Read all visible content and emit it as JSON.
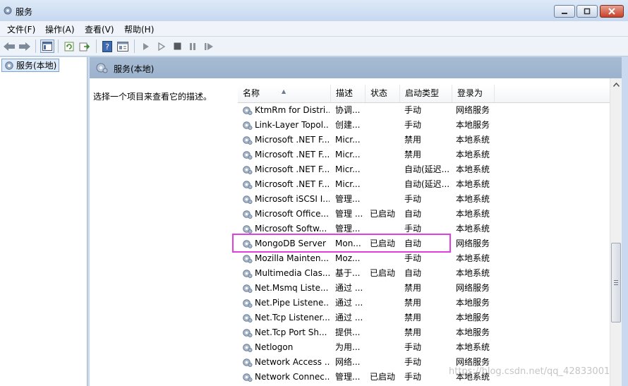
{
  "window": {
    "title": "服务"
  },
  "menu": [
    {
      "label": "文件(F)"
    },
    {
      "label": "操作(A)"
    },
    {
      "label": "查看(V)"
    },
    {
      "label": "帮助(H)"
    }
  ],
  "tree": {
    "selected_label": "服务(本地)"
  },
  "right_header": {
    "title": "服务(本地)"
  },
  "description_pane": {
    "text": "选择一个项目来查看它的描述。"
  },
  "table": {
    "columns": [
      "名称",
      "描述",
      "状态",
      "启动类型",
      "登录为"
    ],
    "sorted_column": "名称",
    "rows": [
      {
        "name": "KtmRm for Distri...",
        "desc": "协调...",
        "status": "",
        "startup": "手动",
        "logon": "网络服务"
      },
      {
        "name": "Link-Layer Topol...",
        "desc": "创建...",
        "status": "",
        "startup": "手动",
        "logon": "本地服务"
      },
      {
        "name": "Microsoft .NET F...",
        "desc": "Micr...",
        "status": "",
        "startup": "禁用",
        "logon": "本地系统"
      },
      {
        "name": "Microsoft .NET F...",
        "desc": "Micr...",
        "status": "",
        "startup": "禁用",
        "logon": "本地系统"
      },
      {
        "name": "Microsoft .NET F...",
        "desc": "Micr...",
        "status": "",
        "startup": "自动(延迟...",
        "logon": "本地系统"
      },
      {
        "name": "Microsoft .NET F...",
        "desc": "Micr...",
        "status": "",
        "startup": "自动(延迟...",
        "logon": "本地系统"
      },
      {
        "name": "Microsoft iSCSI I...",
        "desc": "管理...",
        "status": "",
        "startup": "手动",
        "logon": "本地系统"
      },
      {
        "name": "Microsoft Office...",
        "desc": "管理 ...",
        "status": "已启动",
        "startup": "自动",
        "logon": "本地系统"
      },
      {
        "name": "Microsoft Softw...",
        "desc": "管理...",
        "status": "",
        "startup": "手动",
        "logon": "本地系统"
      },
      {
        "name": "MongoDB Server",
        "desc": "Mon...",
        "status": "已启动",
        "startup": "自动",
        "logon": "网络服务"
      },
      {
        "name": "Mozilla Mainten...",
        "desc": "Moz...",
        "status": "",
        "startup": "手动",
        "logon": "本地系统"
      },
      {
        "name": "Multimedia Clas...",
        "desc": "基于...",
        "status": "已启动",
        "startup": "自动",
        "logon": "本地系统"
      },
      {
        "name": "Net.Msmq Liste...",
        "desc": "通过 ...",
        "status": "",
        "startup": "禁用",
        "logon": "网络服务"
      },
      {
        "name": "Net.Pipe Listene...",
        "desc": "通过 ...",
        "status": "",
        "startup": "禁用",
        "logon": "本地服务"
      },
      {
        "name": "Net.Tcp Listener...",
        "desc": "通过 ...",
        "status": "",
        "startup": "禁用",
        "logon": "本地服务"
      },
      {
        "name": "Net.Tcp Port Sh...",
        "desc": "提供...",
        "status": "",
        "startup": "禁用",
        "logon": "本地服务"
      },
      {
        "name": "Netlogon",
        "desc": "为用...",
        "status": "",
        "startup": "手动",
        "logon": "本地系统"
      },
      {
        "name": "Network Access ...",
        "desc": "网络...",
        "status": "",
        "startup": "手动",
        "logon": "网络服务"
      },
      {
        "name": "Network Connec...",
        "desc": "管理...",
        "status": "已启动",
        "startup": "手动",
        "logon": "本地系统"
      }
    ]
  },
  "highlighted_row": "MongoDB Server",
  "watermark": {
    "text": "https://blog.csdn.net/qq_42833001"
  },
  "colors": {
    "highlight": "#e23ee0",
    "header_bar": "#a7bbd3",
    "window_bg": "#c9daf0"
  },
  "icons": {
    "service": "gear-icon",
    "toolbar": [
      "back-arrow-icon",
      "forward-arrow-icon",
      "console-tree-icon",
      "refresh-icon",
      "export-icon",
      "help-icon",
      "properties-icon",
      "play-icon",
      "play-alt-icon",
      "stop-icon",
      "pause-icon",
      "restart-icon"
    ]
  }
}
